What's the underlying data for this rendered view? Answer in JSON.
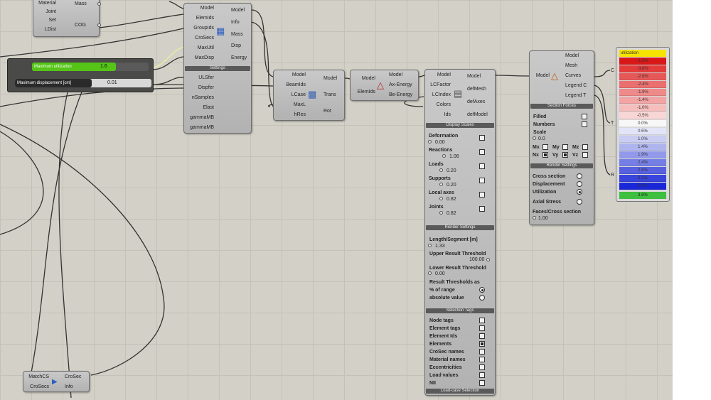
{
  "nodes": {
    "material_node": {
      "inputs": [
        "Material",
        "Joint",
        "Set",
        "LDist"
      ],
      "outputs": [
        "Mass",
        "COG"
      ]
    },
    "assemble_node": {
      "inputs": [
        "Model",
        "ElemIds",
        "GroupIds",
        "CroSecs",
        "MaxUtil",
        "MaxDisp"
      ],
      "outputs": [
        "Model",
        "Info",
        "Mass",
        "Disp",
        "Energy"
      ],
      "settings_header": "Settings",
      "settings_inputs": [
        "ULSfer",
        "Dispfer",
        "nSamples",
        "Elast",
        "gammaMB",
        "gammaMB"
      ]
    },
    "analysis_node": {
      "inputs": [
        "Model",
        "BeamIds",
        "LCase",
        "MaxL",
        "hRes"
      ],
      "outputs": [
        "Model",
        "Trans",
        "Rot"
      ]
    },
    "energy_node": {
      "inputs": [
        "Model",
        "ElemIds"
      ],
      "outputs": [
        "Model",
        "Ax-Energy",
        "Be-Energy"
      ]
    },
    "mesh_node": {
      "inputs": [
        "Model",
        "LCFactor",
        "LCIndex",
        "Colors",
        "Ids"
      ],
      "outputs": [
        "Model",
        "defMesh",
        "defAxes",
        "defModel"
      ],
      "display_header": "Display Scales",
      "scales": [
        {
          "label": "Deformation",
          "value": "0.00"
        },
        {
          "label": "Reactions",
          "value": "1.06"
        },
        {
          "label": "Loads",
          "value": "0.20"
        },
        {
          "label": "Supports",
          "value": "0.20"
        },
        {
          "label": "Local axes",
          "value": "0.82"
        },
        {
          "label": "Joints",
          "value": "0.82"
        }
      ],
      "render_header": "Render Settings",
      "length_label": "Length/Segment [m]",
      "length_value": "1.33",
      "upper_label": "Upper Result Threshold",
      "upper_value": "100.00",
      "lower_label": "Lower Result Threshold",
      "lower_value": "0.00",
      "thresholds_label": "Result Thresholds as",
      "thr_options": [
        {
          "label": "% of range",
          "selected": true
        },
        {
          "label": "absolute value",
          "selected": false
        }
      ],
      "tags_header": "Selection Tags",
      "tags": [
        {
          "label": "Node tags",
          "checked": false
        },
        {
          "label": "Element tags",
          "checked": false
        },
        {
          "label": "Element Ids",
          "checked": false
        },
        {
          "label": "Elements",
          "checked": true
        },
        {
          "label": "CroSec names",
          "checked": false
        },
        {
          "label": "Material names",
          "checked": false
        },
        {
          "label": "Eccentricities",
          "checked": false
        },
        {
          "label": "Load values",
          "checked": false
        },
        {
          "label": "NII",
          "checked": false
        }
      ],
      "loadcase_header": "Load-case Selection"
    },
    "beam_view_node": {
      "inputs": [
        "Model"
      ],
      "outputs": [
        "Model",
        "Mesh",
        "Curves",
        "Legend C",
        "Legend T"
      ],
      "section_header": "Section Forces",
      "filled_label": "Filled",
      "numbers_label": "Numbers",
      "scale_label": "Scale",
      "scale_value": "0.0",
      "forces": [
        {
          "label": "Mx",
          "checked": false
        },
        {
          "label": "My",
          "checked": false
        },
        {
          "label": "Mz",
          "checked": false
        },
        {
          "label": "Nx",
          "checked": true
        },
        {
          "label": "Vy",
          "checked": true
        },
        {
          "label": "Vz",
          "checked": false
        }
      ],
      "render_header": "Render Settings",
      "modes": [
        {
          "label": "Cross section",
          "selected": false
        },
        {
          "label": "Displacement",
          "selected": false
        },
        {
          "label": "Utilization",
          "selected": true
        },
        {
          "label": "Axial Stress",
          "selected": false
        }
      ],
      "faces_label": "Faces/Cross section",
      "faces_value": "1.00"
    },
    "crosec_node": {
      "inputs": [
        "MatchCS",
        "CroSecs"
      ],
      "outputs": [
        "CroSec",
        "Info"
      ]
    }
  },
  "sliders": [
    {
      "name": "Maximum utilization",
      "value": "1.6",
      "fill": 0.72
    },
    {
      "name": "Maximum displacement [cm]",
      "value": "0.01",
      "fill": 0.05
    }
  ],
  "legend": {
    "port_labels": [
      "C",
      "T",
      "R"
    ],
    "title": "utilization",
    "rows": [
      "-1.9%",
      "-3.8%",
      "-2.8%",
      "-2.4%",
      "-1.9%",
      "-1.4%",
      "-1.0%",
      "-0.5%",
      "0.0%",
      "0.5%",
      "1.0%",
      "1.4%",
      "1.9%",
      "2.4%",
      "2.8%",
      "3.3%",
      "3.8%"
    ],
    "row_colors": [
      "#d81818",
      "#e33a3a",
      "#e65757",
      "#ea7070",
      "#ee8a8a",
      "#f2a3a3",
      "#f6bdbd",
      "#f9d6d6",
      "#f7f7f7",
      "#e2e4f7",
      "#c9cdf2",
      "#aeb4ee",
      "#9299ea",
      "#757ee5",
      "#5761e0",
      "#3944dc",
      "#1a27d8"
    ],
    "footer": "3.8%",
    "title_color": "#f5e400",
    "footer_color": "#3fbf3f"
  },
  "colors": {
    "canvas": "#d3d1c7",
    "wire": "#2b2b2b",
    "slider_green": "#55c417"
  }
}
